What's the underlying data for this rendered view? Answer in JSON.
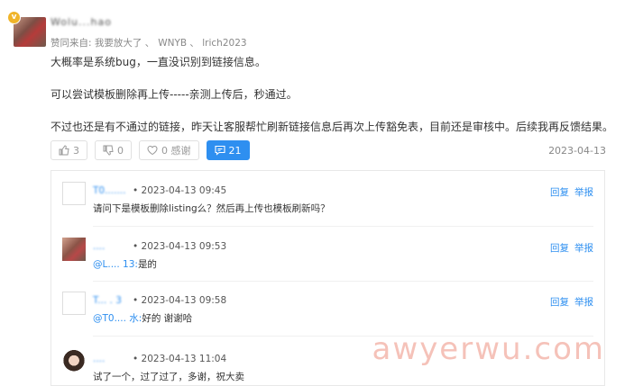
{
  "post": {
    "author_blurred": "Wolu...hao",
    "approvers_label": "赞同来自: 我要放大了 、",
    "approvers_names": "WNYB 、 lrich2023",
    "paragraphs": [
      "大概率是系统bug，一直没识别到链接信息。",
      "可以尝试模板删除再上传-----亲测上传后，秒通过。",
      "不过也还是有不通过的链接，昨天让客服帮忙刷新链接信息后再次上传豁免表，目前还是审核中。后续我再反馈结果。"
    ],
    "actions": {
      "up_count": "3",
      "down_count": "0",
      "thanks_label": "0 感谢",
      "comments_count": "21"
    },
    "date": "2023-04-13"
  },
  "replies": [
    {
      "name_blurred": "T0.......",
      "time": "• 2023-04-13 09:45",
      "text": "请问下是模板删除listing么？然后再上传也模板刷新吗？",
      "mention": "",
      "reply_label": "回复",
      "report_label": "举报"
    },
    {
      "name_blurred": "....",
      "time": "• 2023-04-13 09:53",
      "mention": "@L.... 13:",
      "text": "是的",
      "reply_label": "回复",
      "report_label": "举报"
    },
    {
      "name_blurred": "T... . 3",
      "time": "• 2023-04-13 09:58",
      "mention": "@T0.... 水:",
      "text": "好的 谢谢哈",
      "reply_label": "回复",
      "report_label": "举报"
    },
    {
      "name_blurred": "....",
      "time": "• 2023-04-13 11:04",
      "mention": "",
      "text": "试了一个，过了过了，多谢，祝大卖",
      "reply_label": "回复",
      "report_label": "举报"
    }
  ],
  "watermark": "awyerwu.com",
  "colors": {
    "accent": "#2e8ff0",
    "badge": "#f0b429",
    "watermark": "#f4b8ad"
  },
  "icons": [
    "verified-badge-icon",
    "thumbs-up-icon",
    "thumbs-down-icon",
    "heart-icon",
    "comment-icon"
  ]
}
